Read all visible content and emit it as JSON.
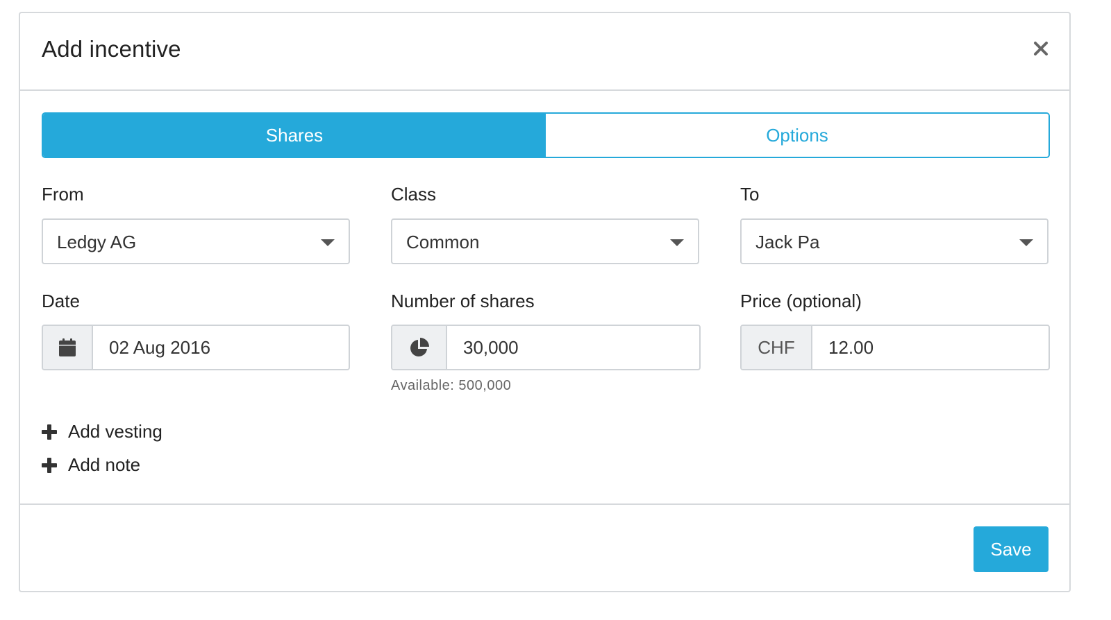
{
  "modal": {
    "title": "Add incentive"
  },
  "tabs": [
    {
      "label": "Shares",
      "active": true
    },
    {
      "label": "Options",
      "active": false
    }
  ],
  "fields": {
    "from": {
      "label": "From",
      "value": "Ledgy AG"
    },
    "class": {
      "label": "Class",
      "value": "Common"
    },
    "to": {
      "label": "To",
      "value": "Jack Pa"
    },
    "date": {
      "label": "Date",
      "value": "02 Aug 2016",
      "icon": "calendar-icon"
    },
    "shares": {
      "label": "Number of shares",
      "value": "30,000",
      "icon": "pie-chart-icon",
      "help": "Available: 500,000"
    },
    "price": {
      "label": "Price (optional)",
      "currency": "CHF",
      "value": "12.00"
    }
  },
  "actions": {
    "add_vesting": "Add vesting",
    "add_note": "Add note",
    "save": "Save"
  },
  "colors": {
    "accent": "#25a9da",
    "border": "#cfd3d7",
    "addon_bg": "#eef0f2"
  }
}
